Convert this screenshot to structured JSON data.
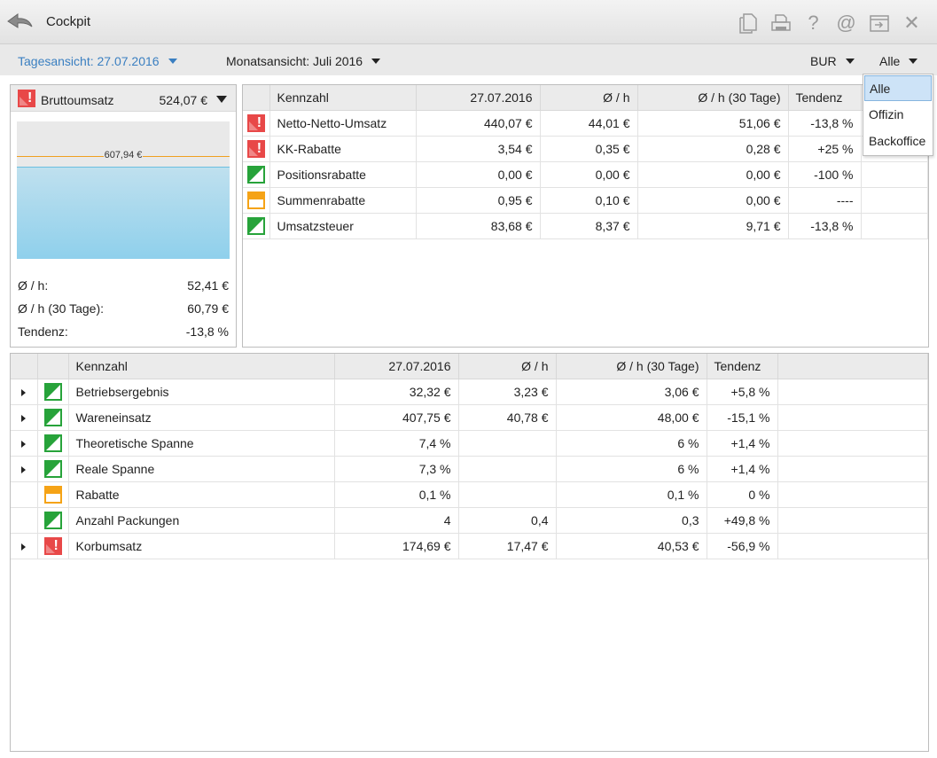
{
  "window": {
    "title": "Cockpit"
  },
  "icons": [
    "back-arrow-icon",
    "document-icon",
    "printer-icon",
    "help-icon",
    "at-icon",
    "export-icon",
    "close-icon"
  ],
  "toolbar": {
    "day_view": "Tagesansicht: 27.07.2016",
    "month_view": "Monatsansicht: Juli 2016",
    "currency": "BUR",
    "filter": "Alle"
  },
  "filter_dropdown": {
    "options": [
      "Alle",
      "Offizin",
      "Backoffice"
    ],
    "selected": "Alle"
  },
  "gross_sales": {
    "label": "Bruttoumsatz",
    "value": "524,07 €",
    "gauge_marker_label": "607,94 €",
    "gauge_fill_fraction": 0.67,
    "gauge_marker_fraction": 0.75,
    "stats": [
      {
        "label": "Ø / h:",
        "value": "52,41 €"
      },
      {
        "label": "Ø / h (30 Tage):",
        "value": "60,79 €"
      },
      {
        "label": "Tendenz:",
        "value": "-13,8 %"
      }
    ]
  },
  "top_table": {
    "headers": [
      "Kennzahl",
      "27.07.2016",
      "Ø / h",
      "Ø / h (30 Tage)",
      "Tendenz"
    ],
    "rows": [
      {
        "status": "red",
        "name": "Netto-Netto-Umsatz",
        "day": "440,07 €",
        "avg_h": "44,01 €",
        "avg_30": "51,06 €",
        "trend": "-13,8 %"
      },
      {
        "status": "red",
        "name": "KK-Rabatte",
        "day": "3,54 €",
        "avg_h": "0,35 €",
        "avg_30": "0,28 €",
        "trend": "+25 %"
      },
      {
        "status": "green",
        "name": "Positionsrabatte",
        "day": "0,00 €",
        "avg_h": "0,00 €",
        "avg_30": "0,00 €",
        "trend": "-100 %"
      },
      {
        "status": "orange",
        "name": "Summenrabatte",
        "day": "0,95 €",
        "avg_h": "0,10 €",
        "avg_30": "0,00 €",
        "trend": "----"
      },
      {
        "status": "green",
        "name": "Umsatzsteuer",
        "day": "83,68 €",
        "avg_h": "8,37 €",
        "avg_30": "9,71 €",
        "trend": "-13,8 %"
      }
    ]
  },
  "bottom_table": {
    "headers": [
      "Kennzahl",
      "27.07.2016",
      "Ø / h",
      "Ø / h (30 Tage)",
      "Tendenz"
    ],
    "rows": [
      {
        "expandable": true,
        "status": "green",
        "name": "Betriebsergebnis",
        "day": "32,32 €",
        "avg_h": "3,23 €",
        "avg_30": "3,06 €",
        "trend": "+5,8 %"
      },
      {
        "expandable": true,
        "status": "green",
        "name": "Wareneinsatz",
        "day": "407,75 €",
        "avg_h": "40,78 €",
        "avg_30": "48,00 €",
        "trend": "-15,1 %"
      },
      {
        "expandable": true,
        "status": "green",
        "name": "Theoretische Spanne",
        "day": "7,4 %",
        "avg_h": "",
        "avg_30": "6 %",
        "trend": "+1,4 %"
      },
      {
        "expandable": true,
        "status": "green",
        "name": "Reale Spanne",
        "day": "7,3 %",
        "avg_h": "",
        "avg_30": "6 %",
        "trend": "+1,4 %"
      },
      {
        "expandable": false,
        "status": "orange",
        "name": "Rabatte",
        "day": "0,1 %",
        "avg_h": "",
        "avg_30": "0,1 %",
        "trend": "0 %"
      },
      {
        "expandable": false,
        "status": "green",
        "name": "Anzahl Packungen",
        "day": "4",
        "avg_h": "0,4",
        "avg_30": "0,3",
        "trend": "+49,8 %"
      },
      {
        "expandable": true,
        "status": "red",
        "name": "Korbumsatz",
        "day": "174,69 €",
        "avg_h": "17,47 €",
        "avg_30": "40,53 €",
        "trend": "-56,9 %"
      }
    ]
  }
}
